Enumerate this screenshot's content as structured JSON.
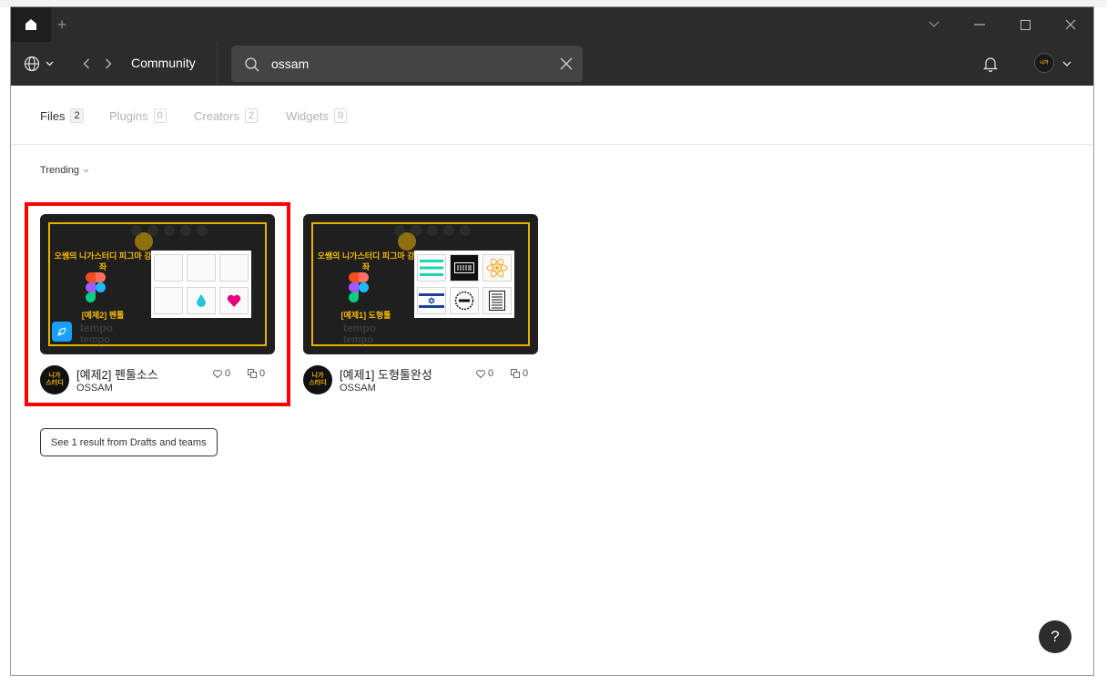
{
  "window": {
    "add_tab": "+"
  },
  "toolbar": {
    "title": "Community"
  },
  "search": {
    "value": "ossam",
    "placeholder": "ossam"
  },
  "filters": [
    {
      "label": "Files",
      "count": "2",
      "active": true
    },
    {
      "label": "Plugins",
      "count": "0",
      "active": false
    },
    {
      "label": "Creators",
      "count": "2",
      "active": false
    },
    {
      "label": "Widgets",
      "count": "0",
      "active": false
    }
  ],
  "sort": {
    "label": "Trending"
  },
  "cards": [
    {
      "title": "[예제2] 펜툴소스",
      "author": "OSSAM",
      "likes": "0",
      "duplicates": "0",
      "thumb_title": "오쌤의 니가스터디 피그마 강좌",
      "thumb_subtitle": "[예제2] 펜툴",
      "thumb_text": "tempo"
    },
    {
      "title": "[예제1] 도형툴완성",
      "author": "OSSAM",
      "likes": "0",
      "duplicates": "0",
      "thumb_title": "오쌤의 니가스터디 피그마 강좌",
      "thumb_subtitle": "[예제1] 도형툴",
      "thumb_text": "tempo"
    }
  ],
  "avatar_text": [
    "니가",
    "스터디"
  ],
  "drafts_button": "See 1 result from Drafts and teams",
  "help_button": "?",
  "colors": {
    "chrome": "#2c2c2c",
    "highlight": "#ff0000",
    "accent_yellow": "#f5b800",
    "badge_blue": "#18a0fb"
  }
}
